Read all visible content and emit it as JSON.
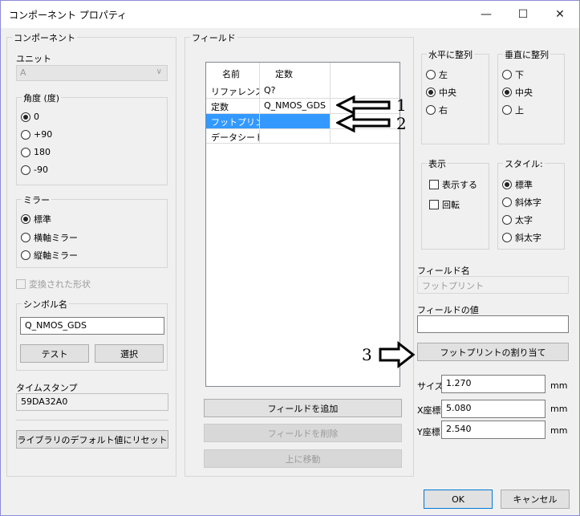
{
  "window": {
    "title": "コンポーネント プロパティ",
    "controls": [
      "—",
      "☐",
      "✕"
    ]
  },
  "component": {
    "group_label": "コンポーネント",
    "unit_label": "ユニット",
    "unit_value": "A",
    "angle": {
      "label": "角度 (度)",
      "options": [
        "0",
        "+90",
        "180",
        "-90"
      ],
      "selected": 0
    },
    "mirror": {
      "label": "ミラー",
      "options": [
        "標準",
        "横軸ミラー",
        "縦軸ミラー"
      ],
      "selected": 0
    },
    "converted_label": "変換された形状",
    "symbol": {
      "label": "シンボル名",
      "value": "Q_NMOS_GDS",
      "test_button": "テスト",
      "select_button": "選択"
    },
    "timestamp": {
      "label": "タイムスタンプ",
      "value": "59DA32A0"
    },
    "reset_button": "ライブラリのデフォルト値にリセット"
  },
  "fields": {
    "group_label": "フィールド",
    "columns": [
      "名前",
      "定数"
    ],
    "rows": [
      {
        "name": "リファレンス",
        "value": "Q?"
      },
      {
        "name": "定数",
        "value": "Q_NMOS_GDS"
      },
      {
        "name": "フットプリント",
        "value": ""
      },
      {
        "name": "データシート",
        "value": ""
      }
    ],
    "selected_row": 2,
    "add_button": "フィールドを追加",
    "delete_button": "フィールドを削除",
    "move_up_button": "上に移動"
  },
  "halign": {
    "label": "水平に整列",
    "options": [
      "左",
      "中央",
      "右"
    ],
    "selected": 1
  },
  "valign": {
    "label": "垂直に整列",
    "options": [
      "下",
      "中央",
      "上"
    ],
    "selected": 1
  },
  "display": {
    "label": "表示",
    "options": [
      "表示する",
      "回転"
    ]
  },
  "style": {
    "label": "スタイル:",
    "options": [
      "標準",
      "斜体字",
      "太字",
      "斜太字"
    ],
    "selected": 0
  },
  "field_name": {
    "label": "フィールド名",
    "value": "フットプリント"
  },
  "field_value": {
    "label": "フィールドの値",
    "value": ""
  },
  "assign_footprint_button": "フットプリントの割り当て",
  "size": {
    "label": "サイズ",
    "value": "1.270",
    "unit": "mm"
  },
  "xpos": {
    "label": "X座標",
    "value": "5.080",
    "unit": "mm"
  },
  "ypos": {
    "label": "Y座標",
    "value": "2.540",
    "unit": "mm"
  },
  "ok_button": "OK",
  "cancel_button": "キャンセル",
  "annotations": [
    "1",
    "2",
    "3"
  ]
}
